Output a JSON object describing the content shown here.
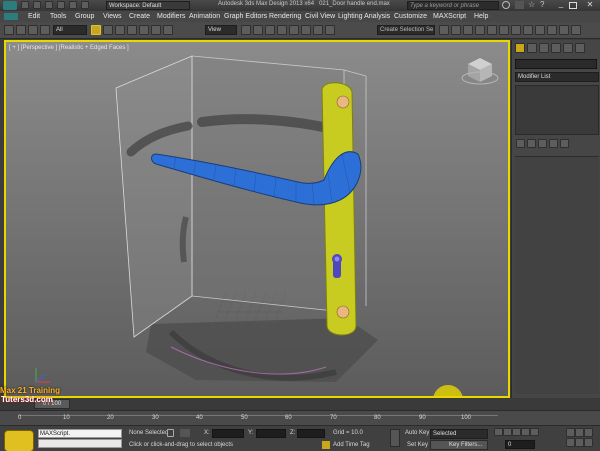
{
  "titlebar": {
    "workspace": "Workspace: Default",
    "title": "Autodesk 3ds Max Design 2013 x64",
    "filename": "021_Door handle end.max",
    "search_placeholder": "Type a keyword or phrase"
  },
  "menubar": {
    "items": [
      "Edit",
      "Tools",
      "Group",
      "Views",
      "Create",
      "Modifiers",
      "Animation",
      "Graph Editors",
      "Rendering",
      "Civil View",
      "Lighting Analysis",
      "Customize",
      "MAXScript",
      "Help"
    ]
  },
  "toolbar": {
    "filter": "All",
    "ref_coord": "View",
    "selection_set": "Create Selection Se"
  },
  "viewport": {
    "label": "[ + ] [Perspective ] [Realistic + Edged Faces ]"
  },
  "command_panel": {
    "modifier_list": "Modifier List"
  },
  "timeline": {
    "frame": "0 / 100",
    "ticks": [
      "0",
      "10",
      "20",
      "30",
      "40",
      "50",
      "60",
      "70",
      "80",
      "90",
      "100"
    ]
  },
  "statusbar": {
    "watermark_line1": "Max 21 Training",
    "watermark_line2": "Tuters3d.com",
    "maxscript": "MAXScript.",
    "selection_status": "None Selected",
    "prompt": "Click or click-and-drag to select objects",
    "x_label": "X:",
    "y_label": "Y:",
    "z_label": "Z:",
    "grid": "Grid = 10.0",
    "add_time_tag": "Add Time Tag",
    "auto_key": "Auto Key",
    "set_key": "Set Key",
    "selected": "Selected",
    "key_filters": "Key Filters...",
    "frame_value": "0"
  },
  "colors": {
    "viewport_border": "#e8d800",
    "handle_blue": "#2c6fd6",
    "plate_yellow": "#c8cc20",
    "autokey_red": "#a32020"
  }
}
